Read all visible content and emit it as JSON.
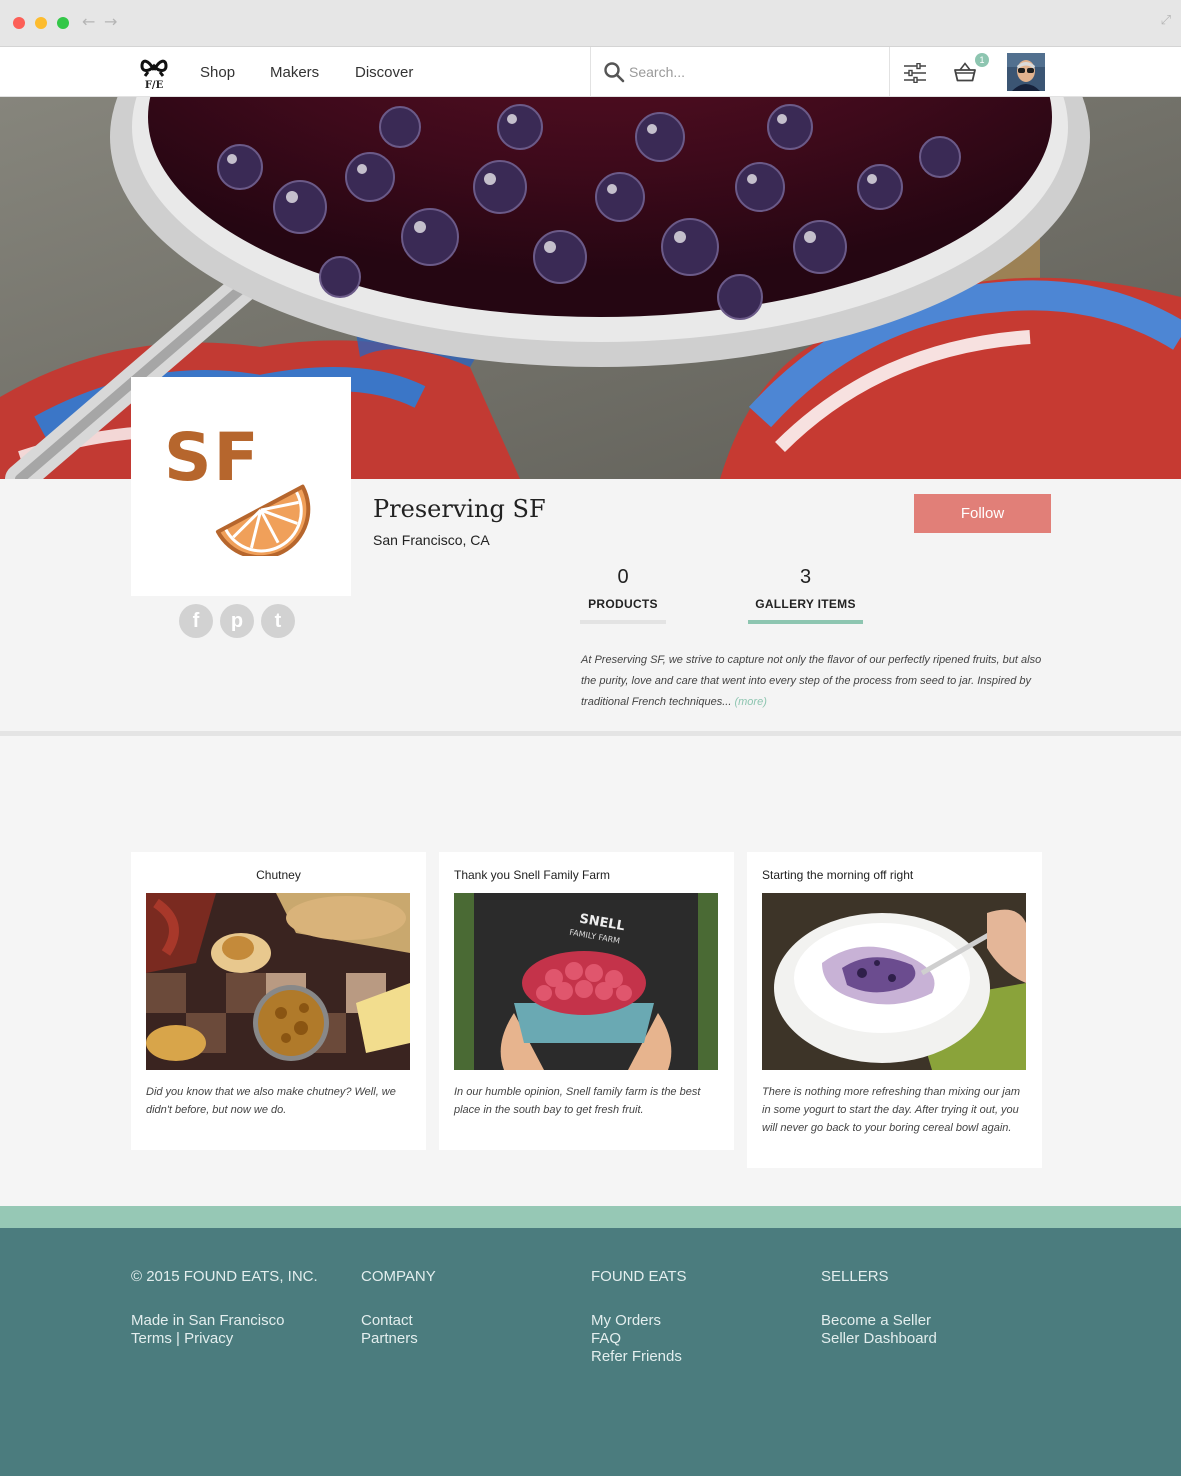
{
  "brand": {
    "logo_text": "F/E"
  },
  "nav": {
    "shop": "Shop",
    "makers": "Makers",
    "discover": "Discover"
  },
  "search": {
    "placeholder": "Search..."
  },
  "cart": {
    "count": "1"
  },
  "shop": {
    "logo_text": "SF",
    "name": "Preserving SF",
    "location": "San Francisco, CA",
    "follow_label": "Follow",
    "stats": [
      {
        "value": "0",
        "label": "PRODUCTS"
      },
      {
        "value": "3",
        "label": "GALLERY ITEMS"
      }
    ],
    "bio": "At Preserving SF, we strive to capture not only the flavor of our perfectly ripened fruits, but also the purity, love and care that went into every step of the process from seed to jar. Inspired by traditional French techniques... ",
    "bio_more": "(more)",
    "social": [
      "f",
      "p",
      "t"
    ]
  },
  "gallery": [
    {
      "title": "Chutney",
      "description": "Did you know that we also make chutney? Well, we didn't before, but now we do."
    },
    {
      "title": "Thank you Snell Family Farm",
      "description": "In our humble opinion, Snell family farm is the best place in the south bay to get fresh fruit.",
      "shirt_text_1": "SNELL",
      "shirt_text_2": "FAMILY FARM"
    },
    {
      "title": "Starting the morning off right",
      "description": "There is nothing more refreshing than mixing our jam in some yogurt to start the day. After trying it out, you will never go back to your boring cereal bowl again."
    }
  ],
  "footer": {
    "copyright": "© 2015 FOUND EATS, INC.",
    "made_in": "Made in San Francisco",
    "terms": "Terms",
    "separator": "|",
    "privacy": "Privacy",
    "company_heading": "COMPANY",
    "contact": "Contact",
    "partners": "Partners",
    "found_eats_heading": "FOUND EATS",
    "my_orders": "My Orders",
    "faq": "FAQ",
    "refer_friends": "Refer Friends",
    "sellers_heading": "SELLERS",
    "become_seller": "Become a Seller",
    "seller_dashboard": "Seller Dashboard"
  },
  "colors": {
    "follow": "#e17f78",
    "accent": "#8dc5b0",
    "footer": "#4b7c7e",
    "logo_brown": "#b6662d",
    "logo_orange": "#f0a05a"
  },
  "icons": [
    "back-arrow-icon",
    "forward-arrow-icon",
    "expand-icon",
    "pretzel-logo-icon",
    "search-icon",
    "filter-sliders-icon",
    "basket-icon",
    "facebook-icon",
    "pinterest-icon",
    "twitter-icon"
  ]
}
